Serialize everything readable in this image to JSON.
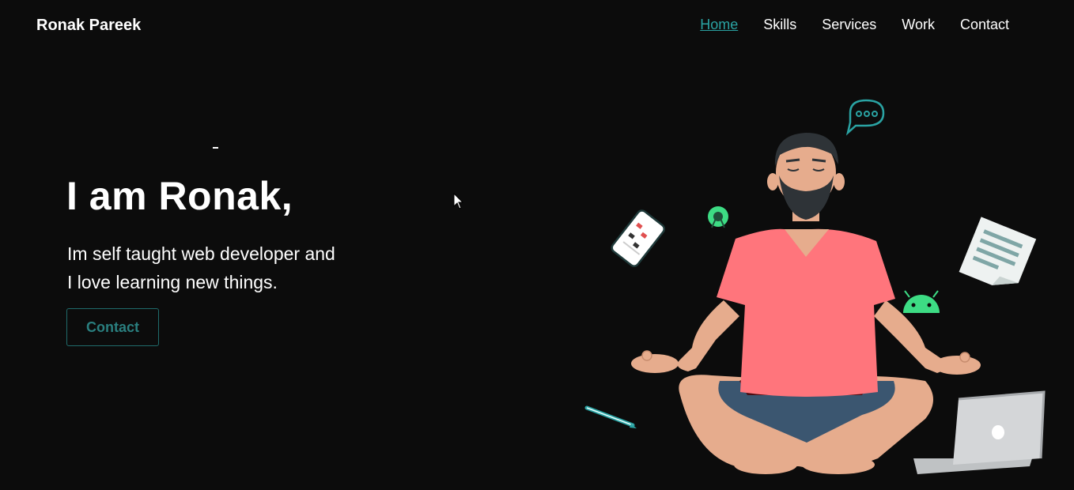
{
  "brand": "Ronak Pareek",
  "nav": {
    "home": "Home",
    "skills": "Skills",
    "services": "Services",
    "work": "Work",
    "contact": "Contact"
  },
  "hero": {
    "title": "I am Ronak,",
    "line1": "Im self taught web developer and",
    "line2": "I love learning new things.",
    "button": "Contact"
  },
  "colors": {
    "background": "#0c0c0c",
    "accent": "#2aa3a3",
    "shirt": "#ff757c"
  }
}
